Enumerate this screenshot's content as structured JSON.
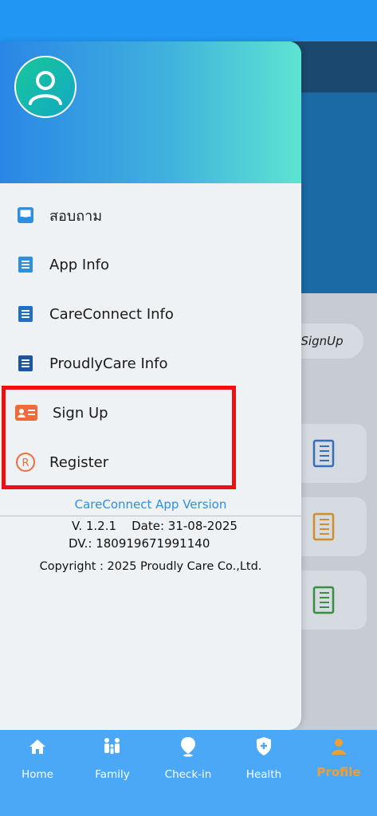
{
  "drawer": {
    "menu_items": [
      {
        "label": "สอบถาม",
        "icon": "inbox-icon"
      },
      {
        "label": "App Info",
        "icon": "document-icon"
      },
      {
        "label": "CareConnect Info",
        "icon": "document-icon"
      },
      {
        "label": "ProudlyCare Info",
        "icon": "document-icon"
      },
      {
        "label": "Sign Up",
        "icon": "id-card-icon"
      },
      {
        "label": "Register",
        "icon": "registered-icon"
      }
    ],
    "version_title": "CareConnect App Version",
    "version_line": "V. 1.2.1    Date: 31-08-2025",
    "dv_line": "DV.: 180919671991140",
    "copyright": "Copyright : 2025 Proudly Care Co.,Ltd."
  },
  "background": {
    "signup_pill": "SignUp"
  },
  "bottom_nav": {
    "items": [
      {
        "label": "Home",
        "icon": "home-icon"
      },
      {
        "label": "Family",
        "icon": "family-icon"
      },
      {
        "label": "Check-in",
        "icon": "location-pin-icon"
      },
      {
        "label": "Health",
        "icon": "shield-plus-icon"
      },
      {
        "label": "Profile",
        "icon": "person-icon"
      }
    ],
    "active": "Profile"
  },
  "colors": {
    "status_bar": "#2196f3",
    "nav_bar": "#4aa8f6",
    "accent_blue": "#2e8fe0",
    "highlight_red": "#ef1010",
    "active_orange": "#f0a030"
  }
}
